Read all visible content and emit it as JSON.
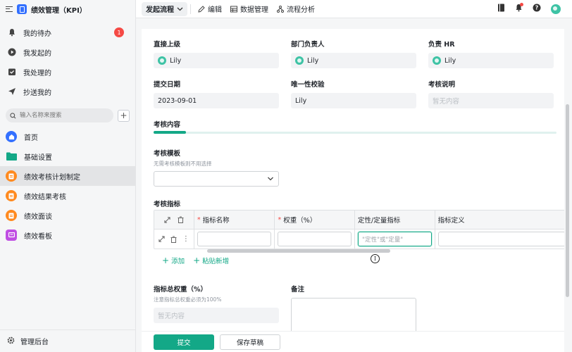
{
  "app": {
    "title": "绩效管理（KPI）"
  },
  "sidebar": {
    "quick": [
      {
        "label": "我的待办",
        "icon": "bell-icon",
        "badge": "1"
      },
      {
        "label": "我发起的",
        "icon": "play-icon"
      },
      {
        "label": "我处理的",
        "icon": "inbox-check-icon"
      },
      {
        "label": "抄送我的",
        "icon": "send-icon"
      }
    ],
    "search_placeholder": "输入名称来搜索",
    "tree": [
      {
        "label": "首页",
        "icon": "home-icon",
        "color": "#3370ff"
      },
      {
        "label": "基础设置",
        "icon": "folder-icon",
        "color": "#13a887"
      },
      {
        "label": "绩效考核计划制定",
        "icon": "form-icon",
        "color": "#ff8a1f"
      },
      {
        "label": "绩效结果考核",
        "icon": "form-icon",
        "color": "#ff8a1f"
      },
      {
        "label": "绩效面谈",
        "icon": "form-icon",
        "color": "#ff8a1f"
      },
      {
        "label": "绩效看板",
        "icon": "dashboard-icon",
        "color": "#c04fe3"
      }
    ],
    "footer_label": "管理后台"
  },
  "toolbar": {
    "start_flow": "发起流程",
    "edit": "编辑",
    "data_mgmt": "数据管理",
    "flow_analysis": "流程分析"
  },
  "form": {
    "direct_superior": {
      "label": "直接上级",
      "value": "Lily"
    },
    "dept_head": {
      "label": "部门负责人",
      "value": "Lily"
    },
    "hr": {
      "label": "负责 HR",
      "value": "Lily"
    },
    "submit_date": {
      "label": "提交日期",
      "value": "2023-09-01"
    },
    "unique_check": {
      "label": "唯一性校验",
      "value": "Lily"
    },
    "review_note": {
      "label": "考核说明",
      "placeholder": "暂无内容"
    },
    "section": "考核内容",
    "template": {
      "label": "考核模板",
      "hint": "无需考核模板则不用选择"
    },
    "indicators": {
      "label": "考核指标",
      "columns": [
        "指标名称",
        "权重（%）",
        "定性/定量指标",
        "指标定义"
      ],
      "qual_placeholder": "\"定性\"或\"定量\"",
      "add": "添加",
      "paste_add": "粘贴新增"
    },
    "total_weight": {
      "label": "指标总权重（%）",
      "hint": "注意指标总权重必须为100%",
      "placeholder": "暂无内容"
    },
    "remark": {
      "label": "备注"
    }
  },
  "footer": {
    "submit": "提交",
    "save_draft": "保存草稿"
  },
  "colors": {
    "accent": "#13a887",
    "brand": "#3370ff",
    "badge": "#f54a45"
  }
}
